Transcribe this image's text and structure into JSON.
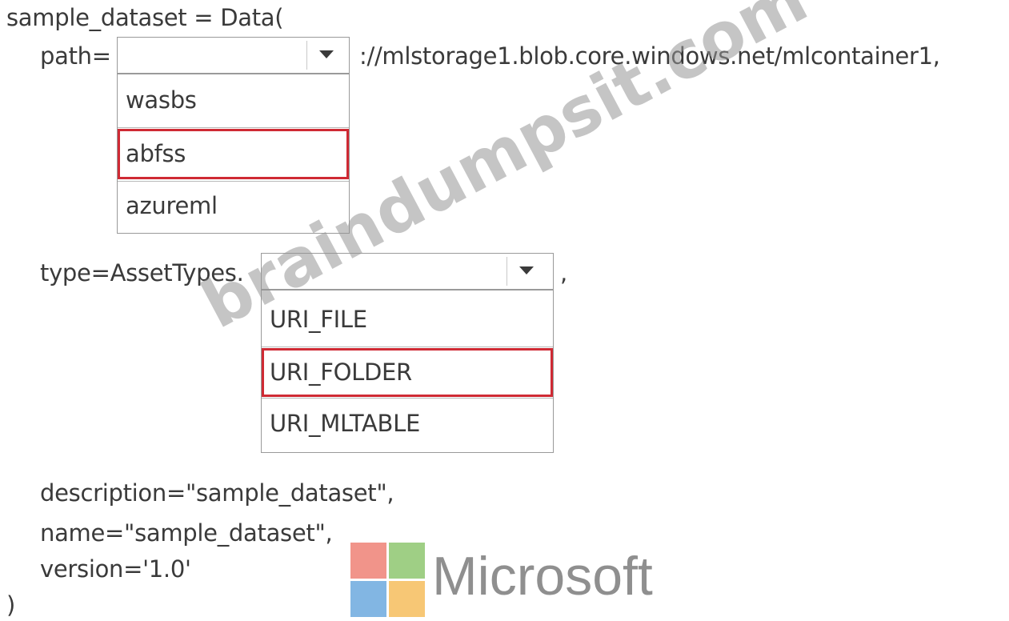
{
  "code": {
    "line1": "sample_dataset = Data(",
    "path_prefix": "path=",
    "path_suffix": "://mlstorage1.blob.core.windows.net/mlcontainer1,",
    "type_prefix": "type=AssetTypes.",
    "type_suffix": ",",
    "description_line": "description=\"sample_dataset\",",
    "name_line": "name=\"sample_dataset\",",
    "version_line": "version='1.0'",
    "closing": ")"
  },
  "path_select": {
    "options": [
      "wasbs",
      "abfss",
      "azureml"
    ],
    "selected_option": "abfss"
  },
  "type_select": {
    "options": [
      "URI_FILE",
      "URI_FOLDER",
      "URI_MLTABLE"
    ],
    "selected_option": "URI_FOLDER"
  },
  "watermark": {
    "text": "braindumpsit.com"
  },
  "logo": {
    "text": "Microsoft",
    "colors": [
      "#f1948a",
      "#9fcf85",
      "#82b6e3",
      "#f7c775"
    ]
  },
  "colors": {
    "selection_border": "#cf2a34",
    "text": "#3a3a3a"
  }
}
